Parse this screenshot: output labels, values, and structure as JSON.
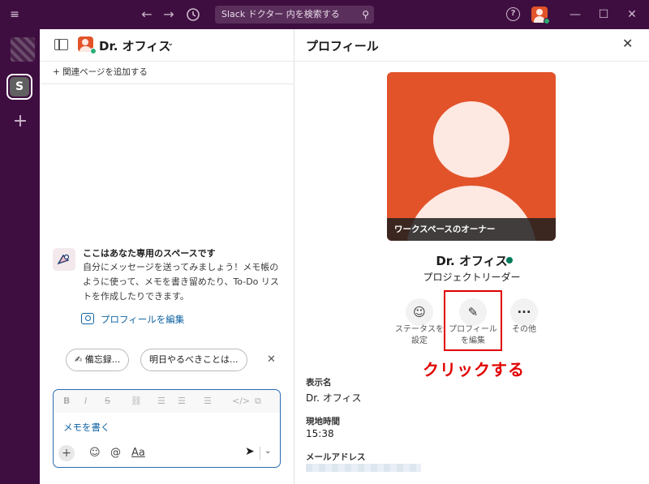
{
  "titlebar": {
    "search_placeholder": "Slack ドクター 内を検索する"
  },
  "rail": {
    "workspace_initial": "S"
  },
  "mid": {
    "title": "Dr. オフィス",
    "add_page": "+ 関連ページを追加する",
    "intro_title": "ここはあなた専用のスペースです",
    "intro_text": "自分にメッセージを送ってみましょう！メモ帳のように使って、メモを書き留めたり、To-Do リストを作成したりできます。",
    "edit_profile_link": "プロフィールを編集",
    "chips": [
      {
        "icon": "✍",
        "label": "備忘録..."
      },
      {
        "label": "明日やるべきことは..."
      }
    ],
    "composer": {
      "placeholder": "メモを書く",
      "format_buttons": [
        "B",
        "I",
        "S",
        "link",
        "ordered-list",
        "bullet-list",
        "blockquote",
        "code",
        "code-block"
      ],
      "aa_label": "Aa"
    }
  },
  "profile": {
    "header_title": "プロフィール",
    "photo_caption": "ワークスペースのオーナー",
    "name": "Dr. オフィス",
    "job_title": "プロジェクトリーダー",
    "actions": [
      {
        "icon": "smile-icon",
        "label_line1": "ステータスを",
        "label_line2": "設定"
      },
      {
        "icon": "pencil-icon",
        "label_line1": "プロフィール",
        "label_line2": "を編集"
      },
      {
        "icon": "more-icon",
        "label_line1": "その他",
        "label_line2": ""
      }
    ],
    "annotation": "クリックする",
    "fields": [
      {
        "label": "表示名",
        "value": "Dr. オフィス"
      },
      {
        "label": "現地時間",
        "value": "15:38"
      },
      {
        "label": "メールアドレス",
        "value": ""
      }
    ]
  },
  "colors": {
    "aubergine": "#3f0e40",
    "avatar_orange": "#e2532a",
    "link_blue": "#1264a3",
    "online_green": "#007a5a",
    "annotation_red": "#e00000"
  }
}
